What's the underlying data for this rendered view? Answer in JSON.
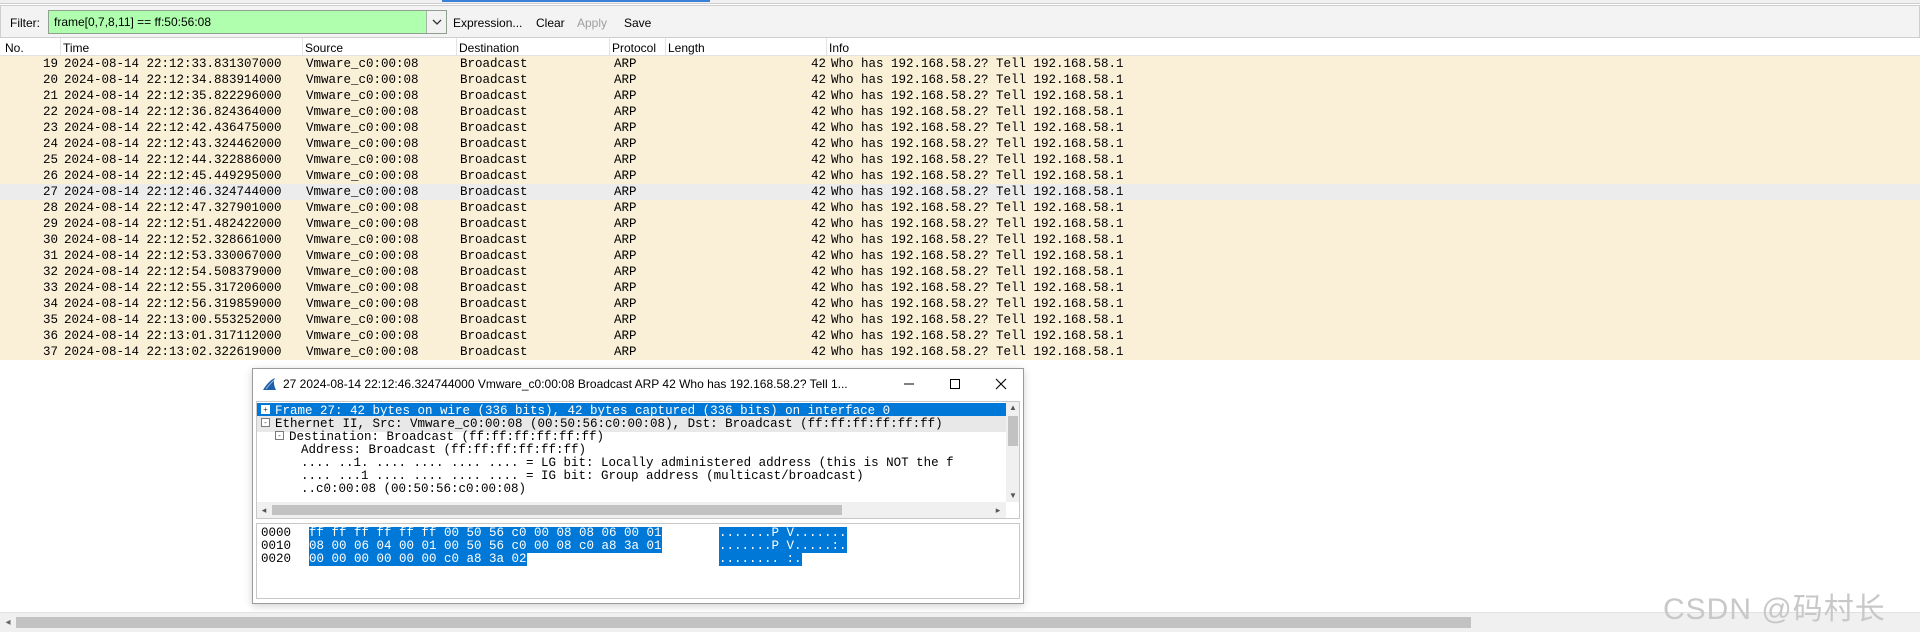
{
  "toolbar": {
    "filter_label": "Filter:",
    "filter_value": "frame[0,7,8,11] == ff:50:56:08",
    "expression_label": "Expression...",
    "clear_label": "Clear",
    "apply_label": "Apply",
    "save_label": "Save",
    "filter_bg_color": "#afffaf"
  },
  "packet_list": {
    "columns": [
      "No.",
      "Time",
      "Source",
      "Destination",
      "Protocol",
      "Length",
      "Info"
    ],
    "row_color": "#faf0d7",
    "selected_row_color": "#ececec",
    "rows": [
      {
        "no": "19",
        "time": "2024-08-14 22:12:33.831307000",
        "source": "Vmware_c0:00:08",
        "destination": "Broadcast",
        "protocol": "ARP",
        "length": "42",
        "info": "Who has 192.168.58.2?  Tell 192.168.58.1"
      },
      {
        "no": "20",
        "time": "2024-08-14 22:12:34.883914000",
        "source": "Vmware_c0:00:08",
        "destination": "Broadcast",
        "protocol": "ARP",
        "length": "42",
        "info": "Who has 192.168.58.2?  Tell 192.168.58.1"
      },
      {
        "no": "21",
        "time": "2024-08-14 22:12:35.822296000",
        "source": "Vmware_c0:00:08",
        "destination": "Broadcast",
        "protocol": "ARP",
        "length": "42",
        "info": "Who has 192.168.58.2?  Tell 192.168.58.1"
      },
      {
        "no": "22",
        "time": "2024-08-14 22:12:36.824364000",
        "source": "Vmware_c0:00:08",
        "destination": "Broadcast",
        "protocol": "ARP",
        "length": "42",
        "info": "Who has 192.168.58.2?  Tell 192.168.58.1"
      },
      {
        "no": "23",
        "time": "2024-08-14 22:12:42.436475000",
        "source": "Vmware_c0:00:08",
        "destination": "Broadcast",
        "protocol": "ARP",
        "length": "42",
        "info": "Who has 192.168.58.2?  Tell 192.168.58.1"
      },
      {
        "no": "24",
        "time": "2024-08-14 22:12:43.324462000",
        "source": "Vmware_c0:00:08",
        "destination": "Broadcast",
        "protocol": "ARP",
        "length": "42",
        "info": "Who has 192.168.58.2?  Tell 192.168.58.1"
      },
      {
        "no": "25",
        "time": "2024-08-14 22:12:44.322886000",
        "source": "Vmware_c0:00:08",
        "destination": "Broadcast",
        "protocol": "ARP",
        "length": "42",
        "info": "Who has 192.168.58.2?  Tell 192.168.58.1"
      },
      {
        "no": "26",
        "time": "2024-08-14 22:12:45.449295000",
        "source": "Vmware_c0:00:08",
        "destination": "Broadcast",
        "protocol": "ARP",
        "length": "42",
        "info": "Who has 192.168.58.2?  Tell 192.168.58.1"
      },
      {
        "no": "27",
        "time": "2024-08-14 22:12:46.324744000",
        "source": "Vmware_c0:00:08",
        "destination": "Broadcast",
        "protocol": "ARP",
        "length": "42",
        "info": "Who has 192.168.58.2?  Tell 192.168.58.1",
        "selected": true
      },
      {
        "no": "28",
        "time": "2024-08-14 22:12:47.327901000",
        "source": "Vmware_c0:00:08",
        "destination": "Broadcast",
        "protocol": "ARP",
        "length": "42",
        "info": "Who has 192.168.58.2?  Tell 192.168.58.1"
      },
      {
        "no": "29",
        "time": "2024-08-14 22:12:51.482422000",
        "source": "Vmware_c0:00:08",
        "destination": "Broadcast",
        "protocol": "ARP",
        "length": "42",
        "info": "Who has 192.168.58.2?  Tell 192.168.58.1"
      },
      {
        "no": "30",
        "time": "2024-08-14 22:12:52.328661000",
        "source": "Vmware_c0:00:08",
        "destination": "Broadcast",
        "protocol": "ARP",
        "length": "42",
        "info": "Who has 192.168.58.2?  Tell 192.168.58.1"
      },
      {
        "no": "31",
        "time": "2024-08-14 22:12:53.330067000",
        "source": "Vmware_c0:00:08",
        "destination": "Broadcast",
        "protocol": "ARP",
        "length": "42",
        "info": "Who has 192.168.58.2?  Tell 192.168.58.1"
      },
      {
        "no": "32",
        "time": "2024-08-14 22:12:54.508379000",
        "source": "Vmware_c0:00:08",
        "destination": "Broadcast",
        "protocol": "ARP",
        "length": "42",
        "info": "Who has 192.168.58.2?  Tell 192.168.58.1"
      },
      {
        "no": "33",
        "time": "2024-08-14 22:12:55.317206000",
        "source": "Vmware_c0:00:08",
        "destination": "Broadcast",
        "protocol": "ARP",
        "length": "42",
        "info": "Who has 192.168.58.2?  Tell 192.168.58.1"
      },
      {
        "no": "34",
        "time": "2024-08-14 22:12:56.319859000",
        "source": "Vmware_c0:00:08",
        "destination": "Broadcast",
        "protocol": "ARP",
        "length": "42",
        "info": "Who has 192.168.58.2?  Tell 192.168.58.1"
      },
      {
        "no": "35",
        "time": "2024-08-14 22:13:00.553252000",
        "source": "Vmware_c0:00:08",
        "destination": "Broadcast",
        "protocol": "ARP",
        "length": "42",
        "info": "Who has 192.168.58.2?  Tell 192.168.58.1"
      },
      {
        "no": "36",
        "time": "2024-08-14 22:13:01.317112000",
        "source": "Vmware_c0:00:08",
        "destination": "Broadcast",
        "protocol": "ARP",
        "length": "42",
        "info": "Who has 192.168.58.2?  Tell 192.168.58.1"
      },
      {
        "no": "37",
        "time": "2024-08-14 22:13:02.322619000",
        "source": "Vmware_c0:00:08",
        "destination": "Broadcast",
        "protocol": "ARP",
        "length": "42",
        "info": "Who has 192.168.58.2?  Tell 192.168.58.1"
      }
    ]
  },
  "dialog": {
    "title": "27 2024-08-14 22:12:46.324744000 Vmware_c0:00:08 Broadcast ARP 42 Who has 192.168.58.2?  Tell 1...",
    "icon": "wireshark-fin-icon",
    "tree": [
      {
        "expander": "+",
        "text": "Frame 27: 42 bytes on wire (336 bits), 42 bytes captured (336 bits) on interface 0",
        "selected": true
      },
      {
        "expander": "-",
        "text": "Ethernet II, Src: Vmware_c0:00:08 (00:50:56:c0:00:08), Dst: Broadcast (ff:ff:ff:ff:ff:ff)",
        "hover": true
      },
      {
        "expander": "-",
        "text": "Destination: Broadcast (ff:ff:ff:ff:ff:ff)"
      },
      {
        "expander": "",
        "text": "Address: Broadcast (ff:ff:ff:ff:ff:ff)"
      },
      {
        "expander": "",
        "text": ".... ..1. .... .... .... .... = LG bit: Locally administered address (this is NOT the f"
      },
      {
        "expander": "",
        "text": ".... ...1 .... .... .... .... = IG bit: Group address (multicast/broadcast)"
      },
      {
        "expander": "",
        "text": "         ..c0:00:08 (00:50:56:c0:00:08)"
      }
    ],
    "hex": [
      {
        "offset": "0000",
        "bytes": "ff ff ff ff ff ff 00 50  56 c0 00 08 08 06 00 01",
        "ascii": ".......P V......."
      },
      {
        "offset": "0010",
        "bytes": "08 00 06 04 00 01 00 50  56 c0 00 08 c0 a8 3a 01",
        "ascii": ".......P V.....:."
      },
      {
        "offset": "0020",
        "bytes": "00 00 00 00 00 00 c0 a8  3a 02",
        "ascii": "........ :."
      }
    ],
    "selection_color": "#0078d7"
  },
  "watermark": "CSDN @码村长"
}
